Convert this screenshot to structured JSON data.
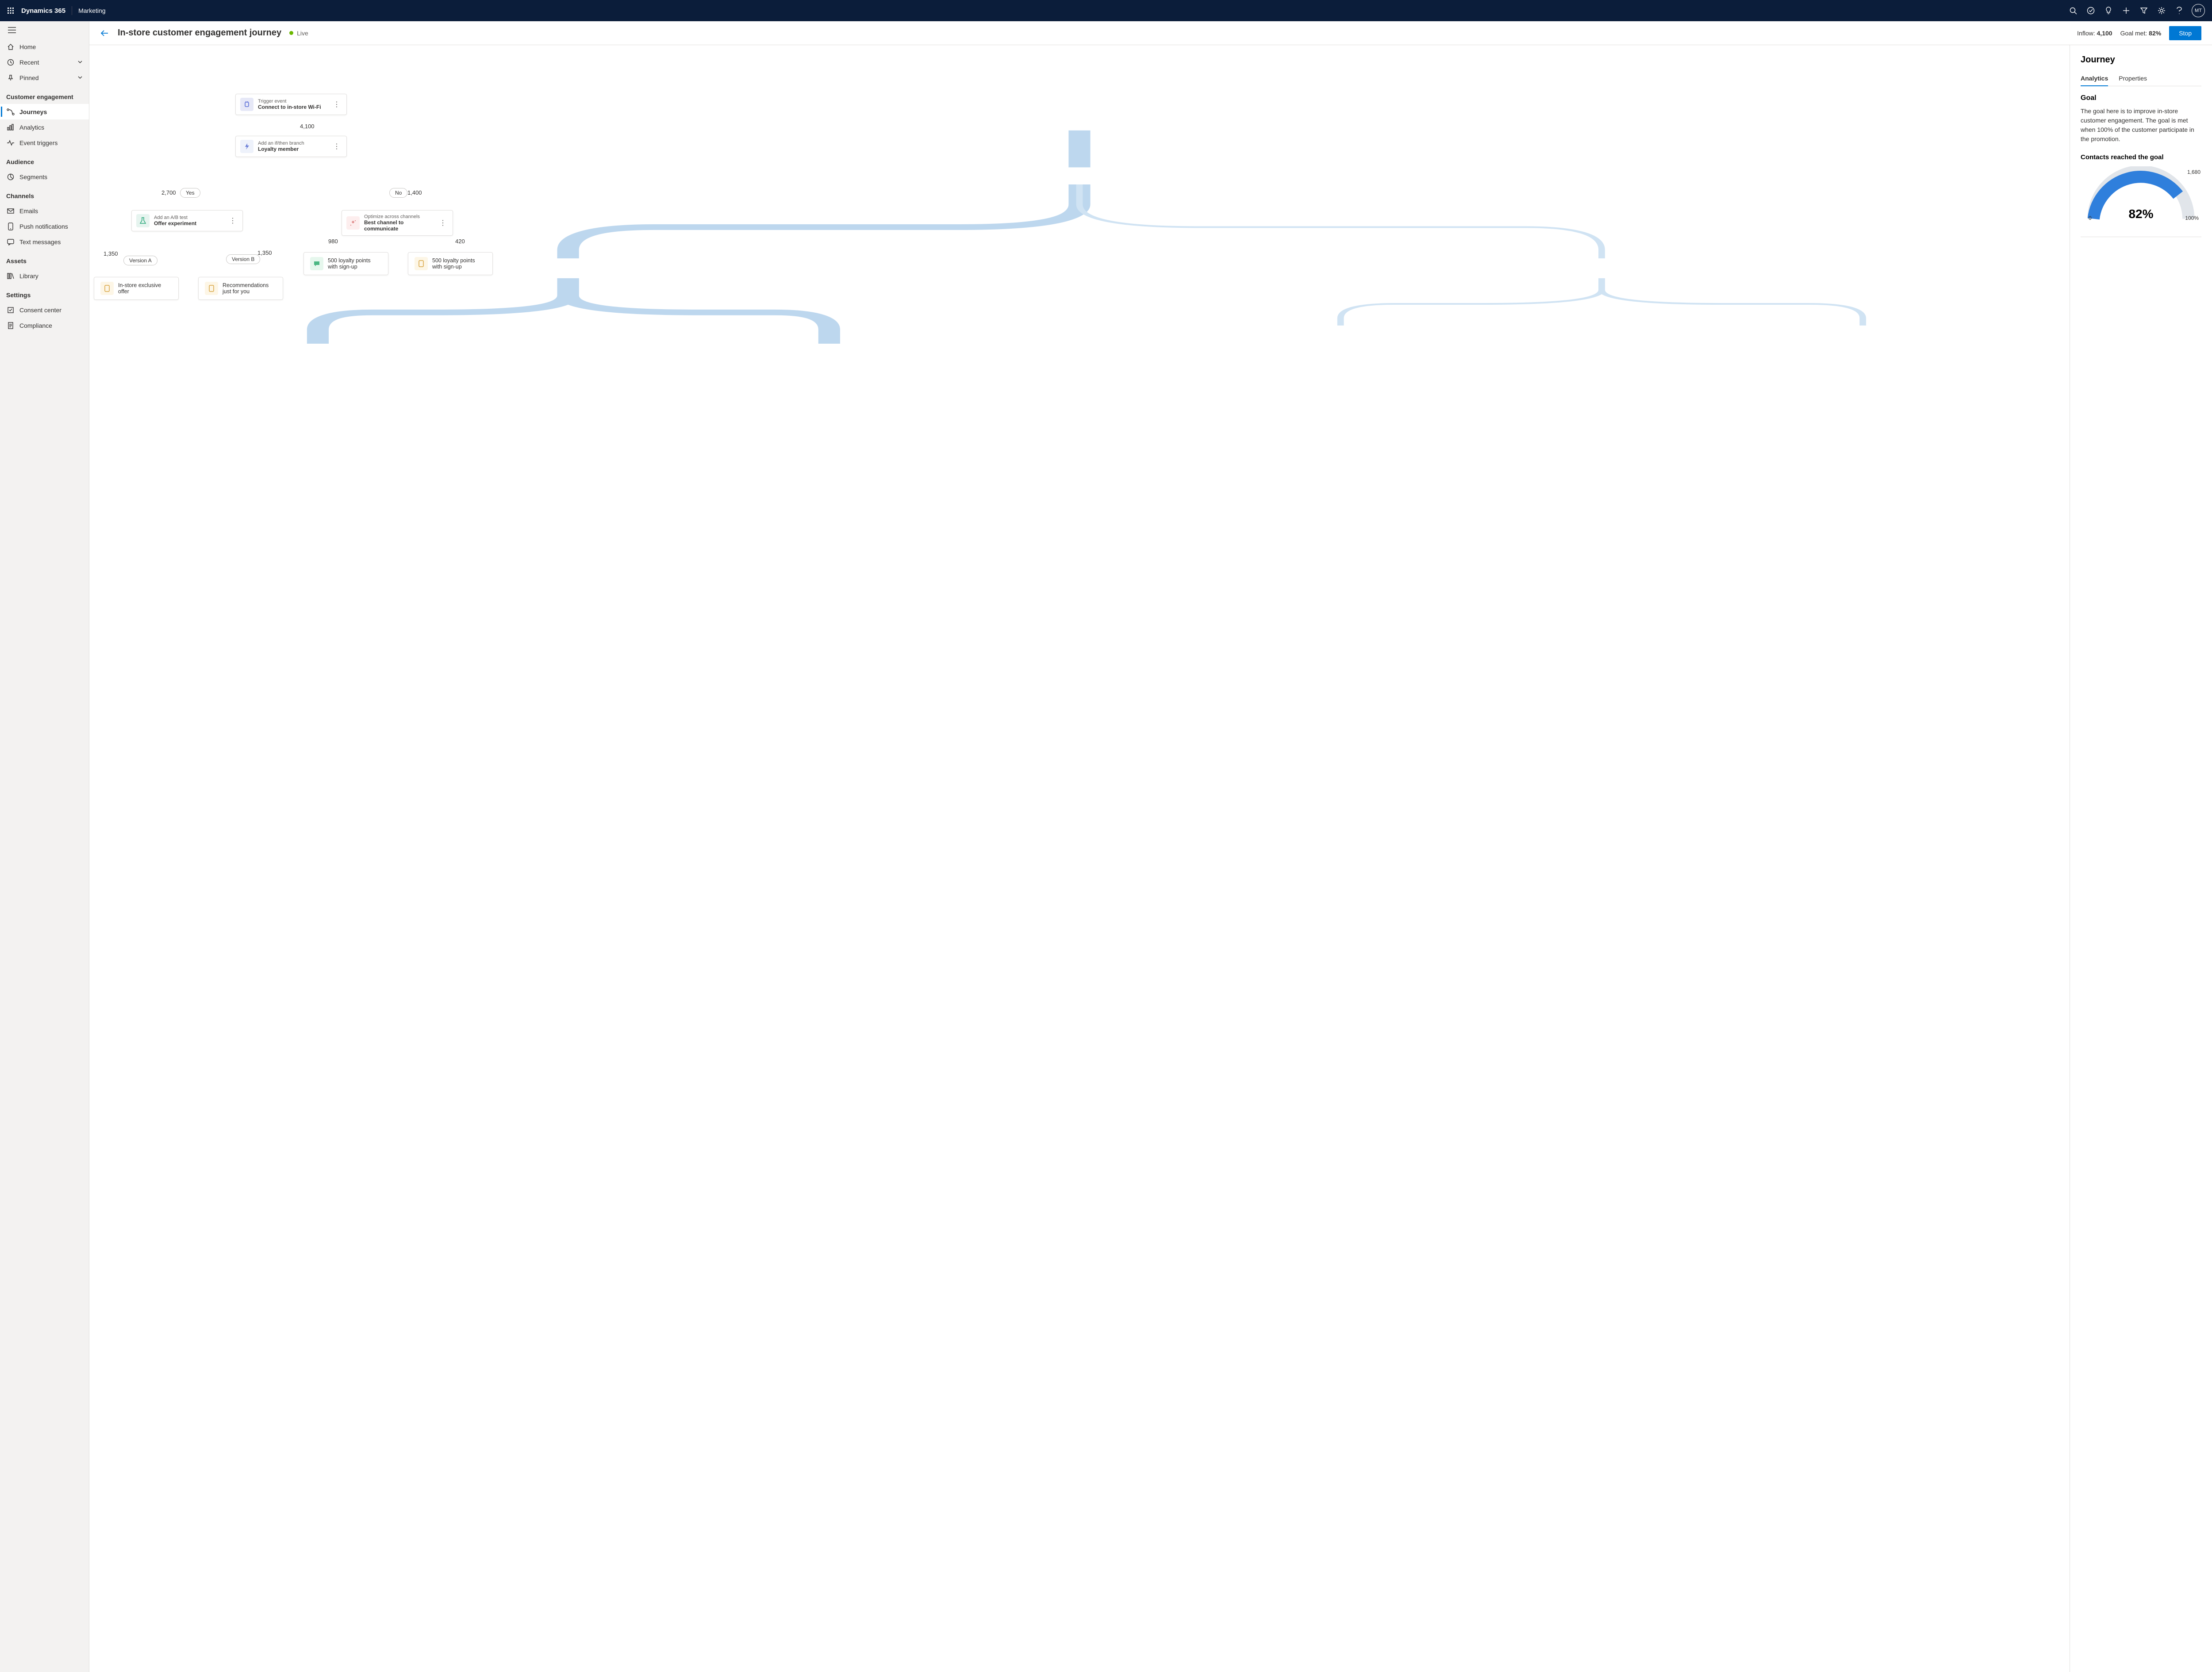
{
  "topbar": {
    "brand": "Dynamics 365",
    "module": "Marketing",
    "avatar_initials": "MT"
  },
  "sidebar": {
    "home": "Home",
    "recent": "Recent",
    "pinned": "Pinned",
    "sections": {
      "customer_engagement": {
        "title": "Customer engagement",
        "journeys": "Journeys",
        "analytics": "Analytics",
        "event_triggers": "Event triggers"
      },
      "audience": {
        "title": "Audience",
        "segments": "Segments"
      },
      "channels": {
        "title": "Channels",
        "emails": "Emails",
        "push": "Push notifications",
        "text": "Text messages"
      },
      "assets": {
        "title": "Assets",
        "library": "Library"
      },
      "settings": {
        "title": "Settings",
        "consent": "Consent center",
        "compliance": "Compliance"
      }
    }
  },
  "header": {
    "title": "In-store customer engagement journey",
    "status": "Live",
    "inflow_label": "Inflow:",
    "inflow_value": "4,100",
    "goal_label": "Goal met:",
    "goal_value": "82%",
    "stop": "Stop"
  },
  "canvas": {
    "trigger": {
      "label": "Trigger event",
      "title": "Connect to in-store Wi-Fi"
    },
    "trigger_count": "4,100",
    "branch": {
      "label": "Add an if/then branch",
      "title": "Loyalty member"
    },
    "yes_count": "2,700",
    "yes_label": "Yes",
    "no_count": "1,400",
    "no_label": "No",
    "ab": {
      "label": "Add an A/B test",
      "title": "Offer experiment"
    },
    "version_a": "Version A",
    "version_b": "Version B",
    "a_count": "1,350",
    "b_count": "1,350",
    "leaf_a": "In-store exclusive offer",
    "leaf_b": "Recommendations just for you",
    "optimize": {
      "label": "Optimize across channels",
      "title": "Best channel to communicate"
    },
    "opt_count1": "980",
    "opt_count2": "420",
    "leaf_c": "500 loyalty points with sign-up",
    "leaf_d": "500 loyalty points with sign-up"
  },
  "panel": {
    "title": "Journey",
    "tab_analytics": "Analytics",
    "tab_properties": "Properties",
    "goal_heading": "Goal",
    "goal_text": "The goal here is to improve in-store customer engagement. The goal is met when 100% of the customer participate in the promotion.",
    "contacts_heading": "Contacts reached the goal",
    "gauge_pct": "82%",
    "gauge_value": "1,680",
    "gauge_min": "0",
    "gauge_max": "100%"
  },
  "chart_data": {
    "type": "gauge",
    "title": "Contacts reached the goal",
    "value_percent": 82,
    "value_absolute": 1680,
    "min": 0,
    "max": 100,
    "unit": "%"
  }
}
